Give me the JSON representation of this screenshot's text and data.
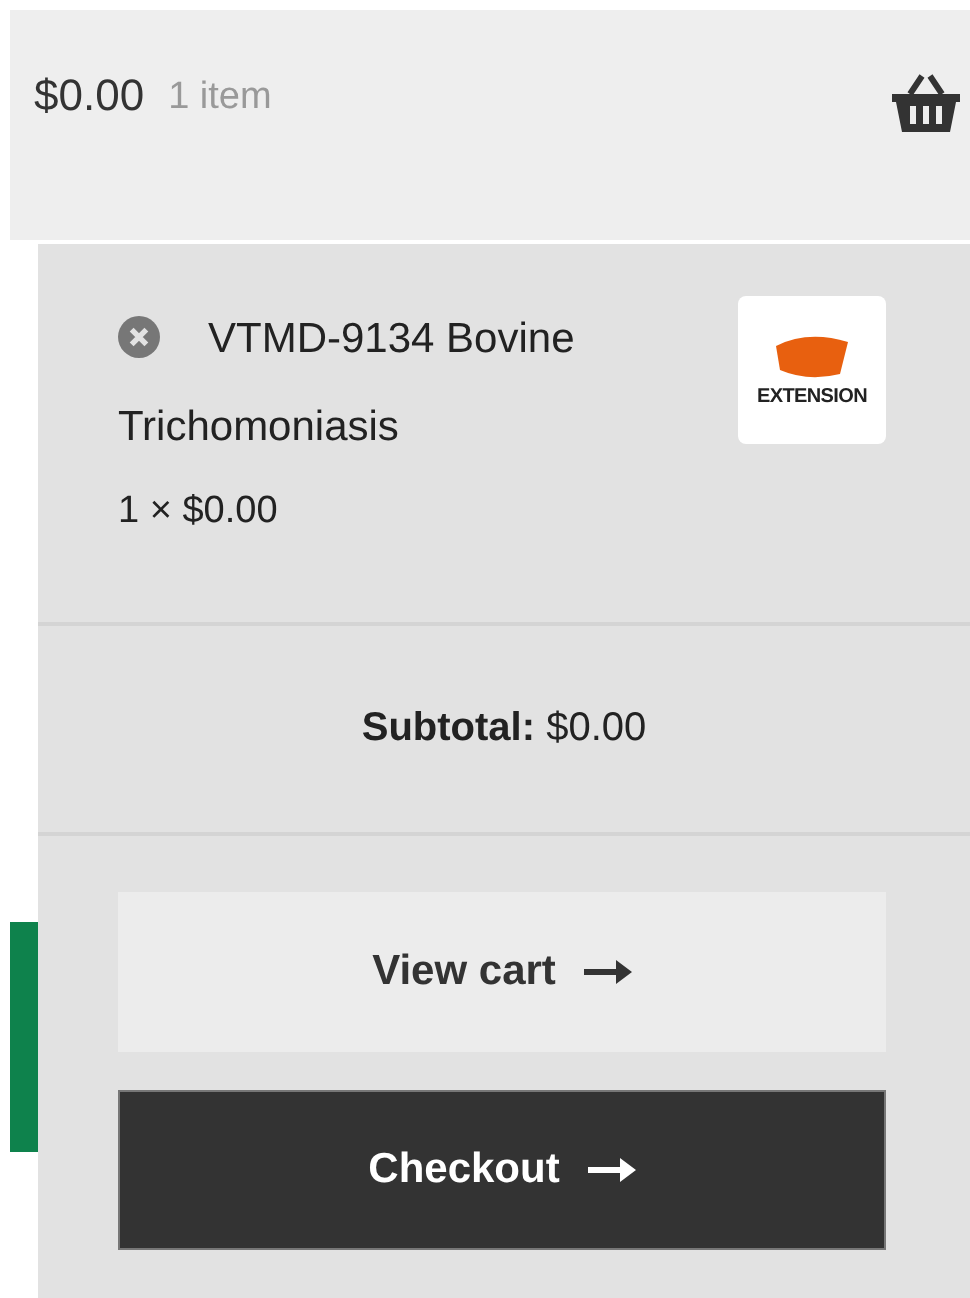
{
  "header": {
    "total": "$0.00",
    "count": "1 item"
  },
  "cart_items": [
    {
      "title": "VTMD-9134 Bovine Trichomoniasis",
      "quantity_price": "1 × $0.00",
      "logo_text": "EXTENSION"
    }
  ],
  "subtotal": "**Subtotal:** $0.00",
  "buttons": [
    {
      "label": "View cart",
      "kind": "secondary"
    },
    {
      "label": "Checkout",
      "kind": "primary"
    }
  ]
}
